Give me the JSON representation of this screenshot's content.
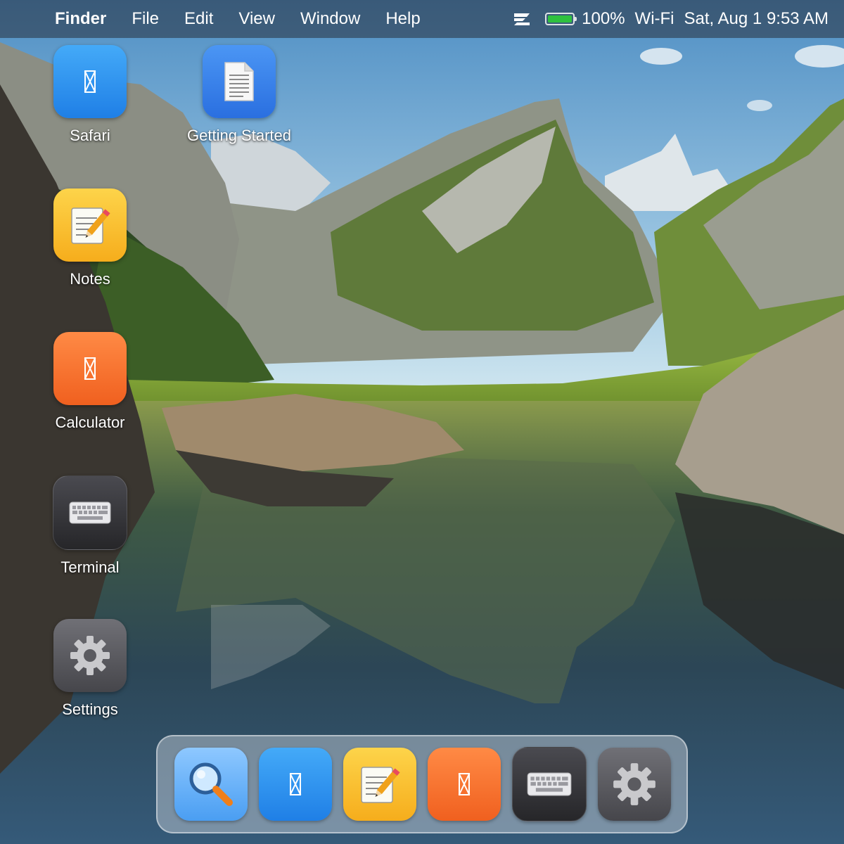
{
  "menubar": {
    "app_name": "Finder",
    "menus": [
      "File",
      "Edit",
      "View",
      "Window",
      "Help"
    ],
    "status": {
      "battery_level": 1.0,
      "battery_text": "100%",
      "wifi": "Wi-Fi",
      "datetime": "Sat, Aug 1 9:53 AM"
    }
  },
  "desktop_icons": [
    {
      "label": "Safari",
      "icon": "safari-icon",
      "color": "#2b8ff0"
    },
    {
      "label": "Getting Started",
      "icon": "document-icon",
      "color": "#3a82ea"
    },
    {
      "label": "Notes",
      "icon": "notes-icon",
      "color": "#f8bd2f"
    },
    {
      "label": "Calculator",
      "icon": "calculator-icon",
      "color": "#f57332"
    },
    {
      "label": "Terminal",
      "icon": "terminal-icon",
      "color": "#333338"
    },
    {
      "label": "Settings",
      "icon": "settings-icon",
      "color": "#5b5b60"
    }
  ],
  "dock": [
    {
      "app": "Finder",
      "icon": "magnifier-icon"
    },
    {
      "app": "Safari",
      "icon": "safari-icon"
    },
    {
      "app": "Notes",
      "icon": "notes-icon"
    },
    {
      "app": "Calculator",
      "icon": "calculator-icon"
    },
    {
      "app": "Terminal",
      "icon": "terminal-icon"
    },
    {
      "app": "Settings",
      "icon": "settings-icon"
    }
  ]
}
